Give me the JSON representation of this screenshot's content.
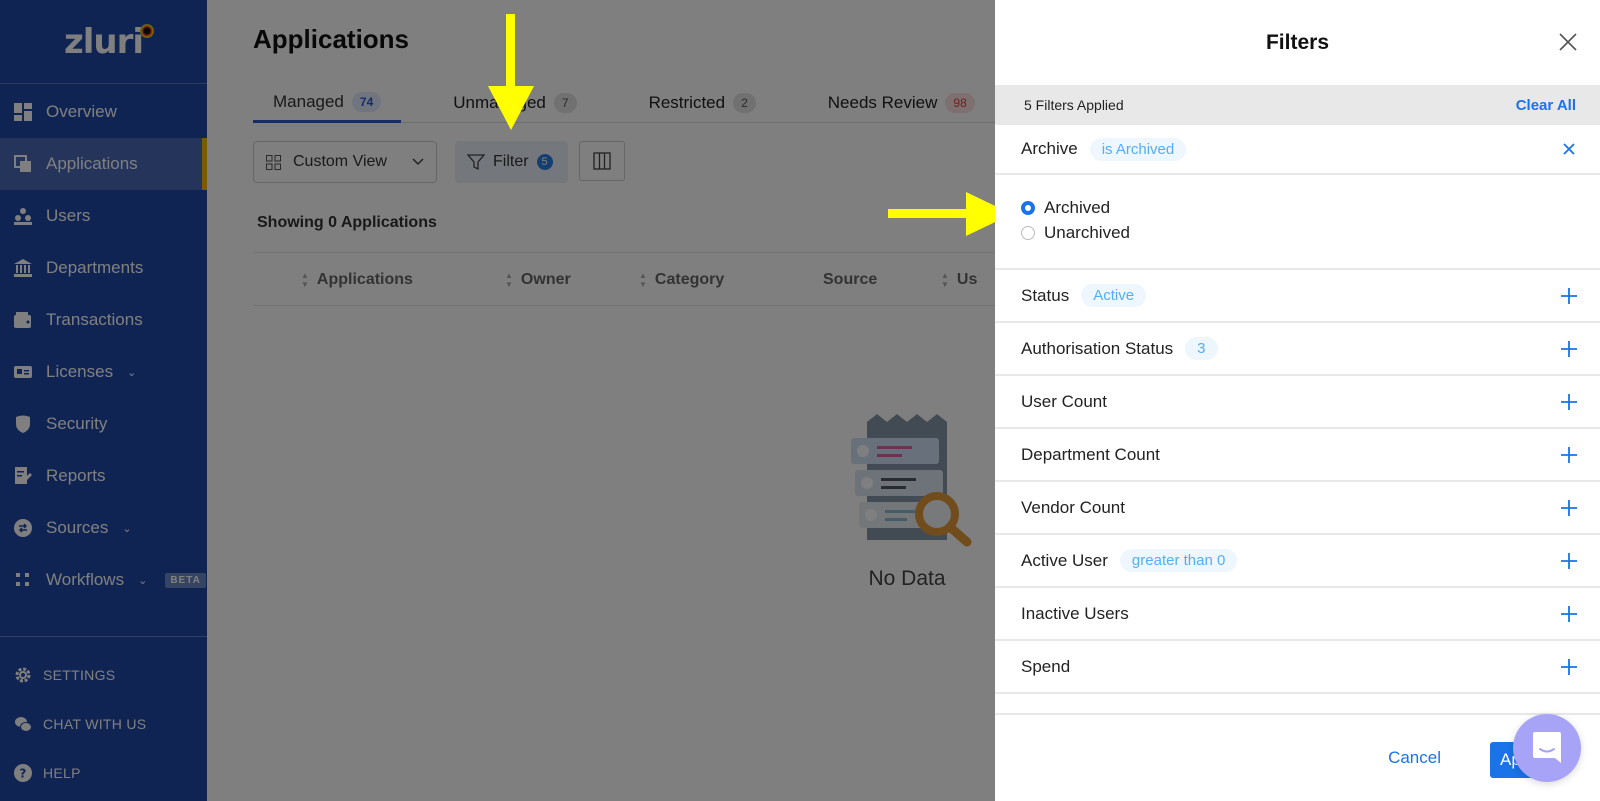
{
  "sidebar": {
    "logo": "zluri",
    "items": [
      {
        "label": "Overview",
        "icon": "overview-icon"
      },
      {
        "label": "Applications",
        "icon": "applications-icon",
        "active": true
      },
      {
        "label": "Users",
        "icon": "users-icon"
      },
      {
        "label": "Departments",
        "icon": "departments-icon"
      },
      {
        "label": "Transactions",
        "icon": "wallet-icon"
      },
      {
        "label": "Licenses",
        "icon": "license-icon",
        "expandable": true
      },
      {
        "label": "Security",
        "icon": "shield-icon"
      },
      {
        "label": "Reports",
        "icon": "reports-icon"
      },
      {
        "label": "Sources",
        "icon": "sources-icon",
        "expandable": true
      },
      {
        "label": "Workflows",
        "icon": "workflows-icon",
        "expandable": true,
        "badge": "BETA"
      }
    ],
    "bottom": [
      {
        "label": "SETTINGS",
        "icon": "gear-icon"
      },
      {
        "label": "CHAT WITH US",
        "icon": "chat-icon"
      },
      {
        "label": "HELP",
        "icon": "help-icon"
      }
    ]
  },
  "main": {
    "title": "Applications",
    "tabs": [
      {
        "label": "Managed",
        "count": "74",
        "active": true
      },
      {
        "label": "Unmanaged",
        "count": "7"
      },
      {
        "label": "Restricted",
        "count": "2"
      },
      {
        "label": "Needs Review",
        "count": "98"
      }
    ],
    "toolbar": {
      "custom_view_label": "Custom View",
      "filter_label": "Filter",
      "filter_count": "5"
    },
    "showing_text": "Showing 0 Applications",
    "columns": [
      "Applications",
      "Owner",
      "Category",
      "Source",
      "Us"
    ],
    "empty_text": "No Data"
  },
  "filters_panel": {
    "title": "Filters",
    "applied_text": "5 Filters Applied",
    "clear_all_label": "Clear All",
    "archive": {
      "label": "Archive",
      "chip": "is Archived",
      "options": [
        {
          "label": "Archived",
          "selected": true
        },
        {
          "label": "Unarchived",
          "selected": false
        }
      ]
    },
    "rows": [
      {
        "label": "Status",
        "chip": "Active"
      },
      {
        "label": "Authorisation Status",
        "chip": "3"
      },
      {
        "label": "User Count",
        "chip": null
      },
      {
        "label": "Department Count",
        "chip": null
      },
      {
        "label": "Vendor Count",
        "chip": null
      },
      {
        "label": "Active User",
        "chip": "greater than 0"
      },
      {
        "label": "Inactive Users",
        "chip": null
      },
      {
        "label": "Spend",
        "chip": null
      }
    ],
    "cancel_label": "Cancel",
    "apply_label": "Apply"
  },
  "colors": {
    "sidebar_bg": "#2049a8",
    "accent": "#1a73e8",
    "chip_text": "#54aef7",
    "active_marker": "#f5b700",
    "annotation_arrow": "#ffff00",
    "chat_bubble": "#a7a4f7"
  }
}
